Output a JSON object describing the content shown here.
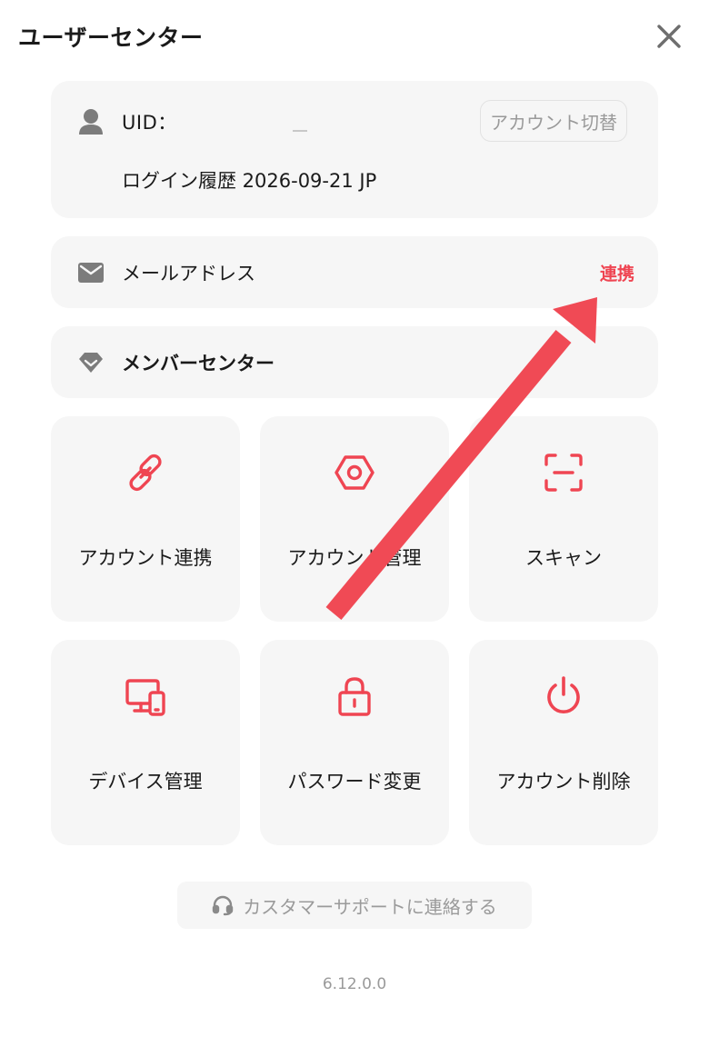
{
  "header": {
    "title": "ユーザーセンター",
    "close_icon": "close-icon"
  },
  "profile": {
    "uid_label": "UID：",
    "switch_account_label": "アカウント切替",
    "login_history": "ログイン履歴 2026-09-21 JP"
  },
  "email": {
    "label": "メールアドレス",
    "action_label": "連携"
  },
  "member": {
    "label": "メンバーセンター"
  },
  "tiles": [
    {
      "label": "アカウント連携",
      "icon": "link-icon"
    },
    {
      "label": "アカウント管理",
      "icon": "hexagon-settings-icon"
    },
    {
      "label": "スキャン",
      "icon": "scan-icon"
    },
    {
      "label": "デバイス管理",
      "icon": "devices-icon"
    },
    {
      "label": "パスワード変更",
      "icon": "lock-icon"
    },
    {
      "label": "アカウント削除",
      "icon": "power-icon"
    }
  ],
  "support": {
    "label": "カスタマーサポートに連絡する"
  },
  "version": "6.12.0.0",
  "colors": {
    "accent": "#ef4552",
    "card_bg": "#f6f6f6",
    "muted_text": "#9a9a9a",
    "icon_gray": "#7c7c7c",
    "annotation_arrow": "#f04a55"
  }
}
